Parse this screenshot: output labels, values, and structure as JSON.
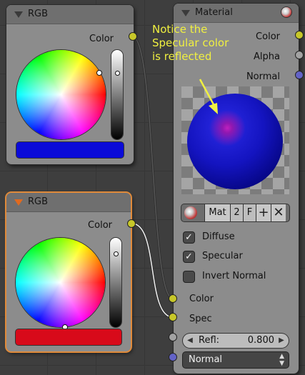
{
  "nodes": {
    "rgb_top": {
      "title": "RGB",
      "output_label": "Color",
      "swatch_color": "#0a0ad8",
      "collapsed_arrow": "down",
      "value_level": 0.78
    },
    "rgb_bottom": {
      "title": "RGB",
      "output_label": "Color",
      "swatch_color": "#d80a1a",
      "collapsed_arrow": "down",
      "value_level": 0.86
    },
    "material": {
      "title": "Material",
      "outputs": [
        "Color",
        "Alpha",
        "Normal"
      ],
      "material_name": "Mat",
      "user_count": "2",
      "fake_user": "F",
      "add_icon": "plus-icon",
      "remove_icon": "x-icon",
      "checkboxes": [
        {
          "label": "Diffuse",
          "checked": true
        },
        {
          "label": "Specular",
          "checked": true
        },
        {
          "label": "Invert Normal",
          "checked": false
        }
      ],
      "inputs": [
        "Color",
        "Spec"
      ],
      "refl_label": "Refl:",
      "refl_value": "0.800",
      "normal_select_value": "Normal",
      "preview_sphere_color": "#1414c0",
      "preview_highlight_color": "#c020c0"
    }
  },
  "annotation": {
    "text": "Notice the Specular color is reflected",
    "color": "#f0f040"
  },
  "socket_colors": {
    "color": "#c7c729",
    "alpha": "#a3a3a3",
    "normal": "#6363c7"
  },
  "icons": {
    "collapse": "triangle-down-icon",
    "node_close": "material-sphere-icon",
    "mat_browse": "material-sphere-icon",
    "mat_check": "checkmark-icon"
  }
}
